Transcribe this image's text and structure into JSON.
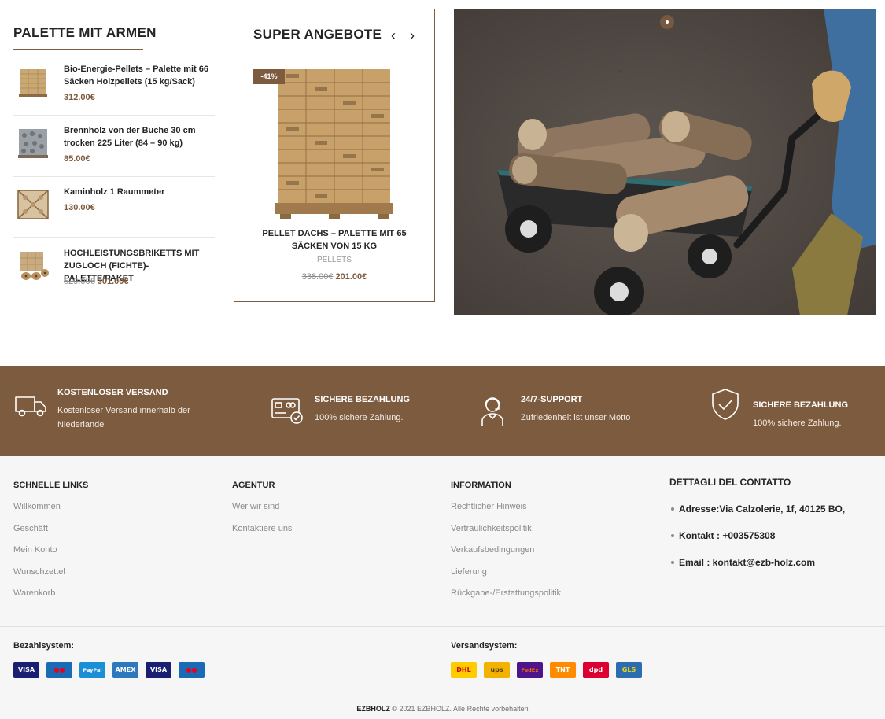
{
  "palette_widget": {
    "title": "PALETTE MIT ARMEN",
    "items": [
      {
        "name": "Bio-Energie-Pellets – Palette mit 66 Säcken Holzpellets (15 kg/Sack)",
        "price": "312.00€",
        "old_price": ""
      },
      {
        "name": "Brennholz von der Buche 30 cm trocken 225 Liter (84 – 90 kg)",
        "price": "85.00€",
        "old_price": ""
      },
      {
        "name": "Kaminholz 1 Raummeter",
        "price": "130.00€",
        "old_price": ""
      },
      {
        "name": "HOCHLEISTUNGSBRIKETTS MIT ZUGLOCH (FICHTE)-PALETTE/PAKET",
        "price": "301.00€",
        "old_price": "529.00€"
      }
    ]
  },
  "offer": {
    "title": "SUPER ANGEBOTE",
    "prev_icon": "chevron-left-icon",
    "next_icon": "chevron-right-icon",
    "prev_glyph": "‹",
    "next_glyph": "›",
    "badge": "-41%",
    "product_name": "PELLET DACHS – PALETTE MIT 65 SÄCKEN VON 15 KG",
    "category": "PELLETS",
    "old_price": "338.00€",
    "price": "201.00€"
  },
  "features": [
    {
      "icon": "truck-icon",
      "title": "KOSTENLOSER VERSAND",
      "desc": "Kostenloser Versand innerhalb der Niederlande"
    },
    {
      "icon": "card-icon",
      "title": "SICHERE BEZAHLUNG",
      "desc": "100% sichere Zahlung."
    },
    {
      "icon": "support-agent-icon",
      "title": "24/7-SUPPORT",
      "desc": "Zufriedenheit ist unser Motto"
    },
    {
      "icon": "shield-check-icon",
      "title": "SICHERE BEZAHLUNG",
      "desc": "100% sichere Zahlung."
    }
  ],
  "footer": {
    "columns": [
      {
        "title": "SCHNELLE LINKS",
        "links": [
          "Willkommen",
          "Geschäft",
          "Mein Konto",
          "Wunschzettel",
          "Warenkorb"
        ]
      },
      {
        "title": "AGENTUR",
        "links": [
          "Wer wir sind",
          "Kontaktiere uns"
        ]
      },
      {
        "title": "INFORMATION",
        "links": [
          "Rechtlicher Hinweis",
          "Vertraulichkeitspolitik",
          "Verkaufsbedingungen",
          "Lieferung",
          "Rückgabe-/Erstattungspolitik"
        ]
      }
    ],
    "contact": {
      "title": "DETTAGLI DEL CONTATTO",
      "address": "Adresse:Via Calzolerie, 1f, 40125  BO,",
      "phone": "Kontakt : +003575308",
      "email": "Email : kontakt@ezb-holz.com"
    },
    "payment_label": "Bezahlsystem:",
    "payment_logos": [
      {
        "label": "VISA",
        "bg": "#1a1f71",
        "fg": "#ffffff"
      },
      {
        "label": "●●",
        "bg": "#1a6bb5",
        "fg": "#eb001b"
      },
      {
        "label": "PayPal",
        "bg": "#1a8fd6",
        "fg": "#ffffff"
      },
      {
        "label": "AMEX",
        "bg": "#2e77bc",
        "fg": "#ffffff"
      },
      {
        "label": "VISA",
        "bg": "#1a1f71",
        "fg": "#ffffff"
      },
      {
        "label": "●●",
        "bg": "#1a6bb5",
        "fg": "#eb001b"
      }
    ],
    "shipping_label": "Versandsystem:",
    "shipping_logos": [
      {
        "label": "DHL",
        "bg": "#ffcc00",
        "fg": "#d40511"
      },
      {
        "label": "ups",
        "bg": "#f2b300",
        "fg": "#5a3a1a"
      },
      {
        "label": "FedEx",
        "bg": "#4d148c",
        "fg": "#ff6600"
      },
      {
        "label": "TNT",
        "bg": "#ff8c00",
        "fg": "#ffffff"
      },
      {
        "label": "dpd",
        "bg": "#dc0032",
        "fg": "#ffffff"
      },
      {
        "label": "GLS",
        "bg": "#2c6cb0",
        "fg": "#f5d400"
      }
    ],
    "copyright_brand": "EZBHOLZ",
    "copyright_text": "© 2021 EZBHOLZ. Alle Rechte vorbehalten"
  },
  "colors": {
    "brown": "#7d5b3f",
    "footer_bg": "#f6f6f6"
  }
}
